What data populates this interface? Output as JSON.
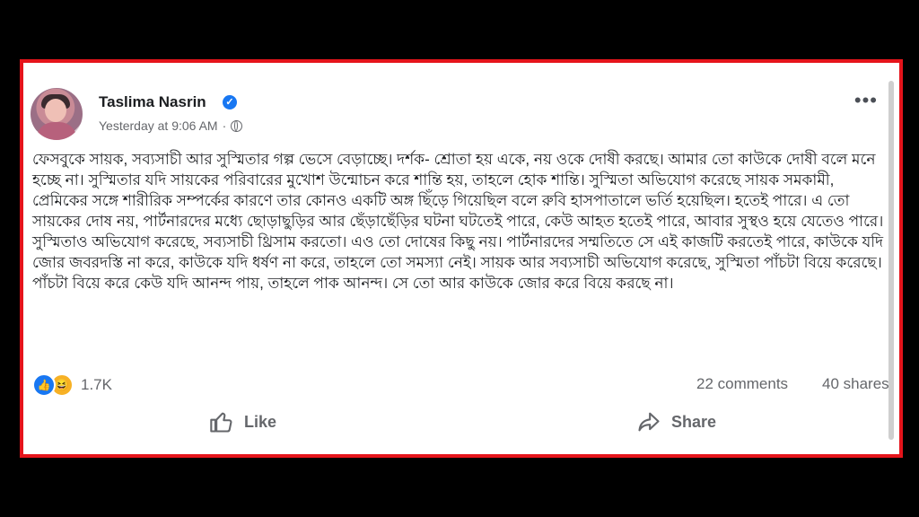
{
  "post": {
    "author": "Taslima Nasrin",
    "verified_icon": "verified-badge-icon",
    "timestamp": "Yesterday at 9:06 AM",
    "separator": "·",
    "privacy_icon": "globe-icon",
    "more_options_icon": "more-options-icon",
    "more_label": "•••",
    "text": "ফেসবুকে সায়ক, সব্যসাচী আর সুস্মিতার গল্প ভেসে বেড়াচ্ছে। দর্শক- শ্রোতা হয় একে, নয় ওকে দোষী করছে। আমার তো কাউকে দোষী বলে মনে হচ্ছে না। সুস্মিতার যদি সায়কের পরিবারের মুখোশ উন্মোচন করে শান্তি হয়, তাহলে হোক শান্তি। সুস্মিতা অভিযোগ করেছে সায়ক সমকামী, প্রেমিকের সঙ্গে শারীরিক সম্পর্কের কারণে তার কোনও একটি অঙ্গ ছিঁড়ে গিয়েছিল বলে রুবি হাসপাতালে ভর্তি হয়েছিল। হতেই পারে। এ তো সায়কের দোষ নয়, পার্টনারদের মধ্যে ছোড়াছুড়ির আর ছেঁড়াছেঁড়ির ঘটনা ঘটতেই পারে, কেউ আহত হতেই পারে, আবার সুস্থও হয়ে যেতেও পারে। সুস্মিতাও অভিযোগ করেছে, সব্যসাচী থ্রিসাম করতো। এও তো দোষের কিছু নয়। পার্টনারদের সম্মতিতে সে এই কাজটি করতেই পারে, কাউকে যদি জোর জবরদস্তি না করে, কাউকে যদি ধর্ষণ না করে, তাহলে তো সমস্যা নেই। সায়ক আর সব্যসাচী অভিযোগ করেছে, সুস্মিতা পাঁচটা বিয়ে করেছে। পাঁচটা বিয়ে করে কেউ যদি আনন্দ পায়, তাহলে পাক আনন্দ। সে তো আর কাউকে জোর করে বিয়ে করছে না।"
  },
  "stats": {
    "like_icon": "like-reaction-icon",
    "haha_icon": "haha-reaction-icon",
    "reaction_count": "1.7K",
    "comments": "22 comments",
    "shares": "40 shares"
  },
  "actions": {
    "like_label": "Like",
    "share_label": "Share"
  },
  "colors": {
    "frame_border": "#e5141b",
    "accent": "#1877f2",
    "muted_text": "#65676b"
  }
}
